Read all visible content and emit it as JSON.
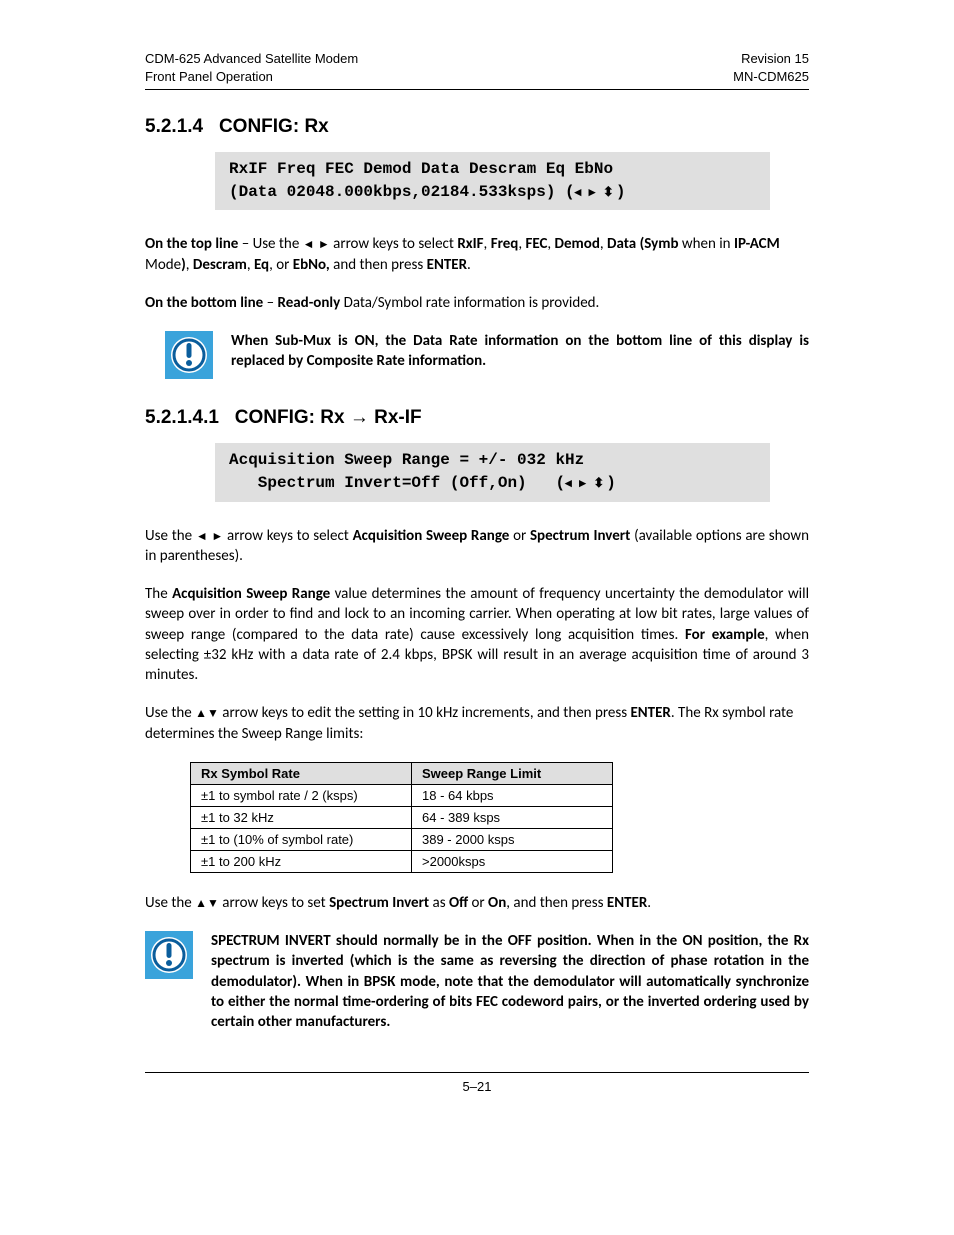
{
  "header": {
    "left_line1": "CDM-625 Advanced Satellite Modem",
    "left_line2": "Front Panel Operation",
    "right_line1": "Revision 15",
    "right_line2": "MN-CDM625"
  },
  "section1": {
    "number": "5.2.1.4",
    "title": "CONFIG: Rx",
    "lcd_line1": "RxIF Freq FEC Demod Data Descram Eq EbNo",
    "lcd_line2_a": "(Data 02048.000kbps,02184.533ksps) (",
    "lcd_line2_b": ")",
    "p1_a": "On the top line",
    "p1_b": " – Use the ",
    "p1_c": " arrow keys to select ",
    "p1_d": "RxIF",
    "p1_e": ", ",
    "p1_f": "Freq",
    "p1_g": ", ",
    "p1_h": "FEC",
    "p1_i": ", ",
    "p1_j": "Demod",
    "p1_k": ", ",
    "p1_l": "Data (Symb",
    "p1_m": " when in ",
    "p1_n": "IP-ACM",
    "p1_o": " Mode",
    "p1_p": ")",
    "p1_q": ", ",
    "p1_r": "Descram",
    "p1_s": ", ",
    "p1_t": "Eq",
    "p1_u": ", or ",
    "p1_v": "EbNo,",
    "p1_w": " and then press ",
    "p1_x": "ENTER",
    "p1_y": ".",
    "p2_a": "On the bottom line",
    "p2_b": " – ",
    "p2_c": "Read-only",
    "p2_d": " Data/Symbol rate information is provided.",
    "note1": "When Sub-Mux is ON, the Data Rate information on the bottom line of this display is replaced by Composite Rate information."
  },
  "section2": {
    "number": "5.2.1.4.1",
    "title": "CONFIG: Rx → Rx-IF",
    "lcd_line1": "Acquisition Sweep Range = +/- 032 kHz",
    "lcd_line2_a": "   Spectrum Invert=Off (Off,On)   (",
    "lcd_line2_b": ")",
    "p1_a": "Use  the  ",
    "p1_b": " arrow  keys  to  select  ",
    "p1_c": "Acquisition  Sweep  Range",
    "p1_d": "  or  ",
    "p1_e": "Spectrum  Invert",
    "p1_f": "  (available options are shown in parentheses).",
    "p2_a": "The ",
    "p2_b": "Acquisition Sweep Range",
    "p2_c": " value determines the amount of frequency uncertainty the demodulator will sweep over in order to find and lock to an incoming carrier. When operating at low bit rates, large values of sweep range (compared to the data rate) cause excessively long acquisition times. ",
    "p2_d": "For example",
    "p2_e": ", when selecting ±32 kHz with a data rate of 2.4 kbps, BPSK will result in an average acquisition time of around 3 minutes.",
    "p3_a": "Use the ",
    "p3_b": " arrow keys to edit the setting in 10 kHz increments, and then press ",
    "p3_c": "ENTER",
    "p3_d": ". The Rx symbol rate determines the Sweep Range limits:",
    "table": {
      "head_col1": "Rx Symbol Rate",
      "head_col2": "Sweep Range Limit",
      "rows": [
        {
          "c1": "±1  to  symbol rate / 2 (ksps)",
          "c2": "18 - 64 kbps"
        },
        {
          "c1": "±1  to  32 kHz",
          "c2": "64 - 389 ksps"
        },
        {
          "c1": "±1  to  (10% of symbol rate)",
          "c2": "389 - 2000 ksps"
        },
        {
          "c1": "±1  to 200 kHz",
          "c2": ">2000ksps"
        }
      ]
    },
    "p4_a": "Use the ",
    "p4_b": " arrow keys to set ",
    "p4_c": "Spectrum Invert",
    "p4_d": " as ",
    "p4_e": "Off",
    "p4_f": " or ",
    "p4_g": "On",
    "p4_h": ", and then press ",
    "p4_i": "ENTER",
    "p4_j": ".",
    "note2": "SPECTRUM INVERT should normally be in the OFF position. When in the ON position, the Rx spectrum is inverted (which is the same as reversing the direction of phase rotation in the demodulator). When in BPSK mode, note that the demodulator will automatically synchronize to either the normal time-ordering of bits FEC codeword pairs, or the inverted ordering used by certain other manufacturers."
  },
  "arrows": {
    "lr": "◄ ►",
    "ud": "▲▼",
    "lcd": "◂ ▸ ⬍"
  },
  "footer": "5–21"
}
